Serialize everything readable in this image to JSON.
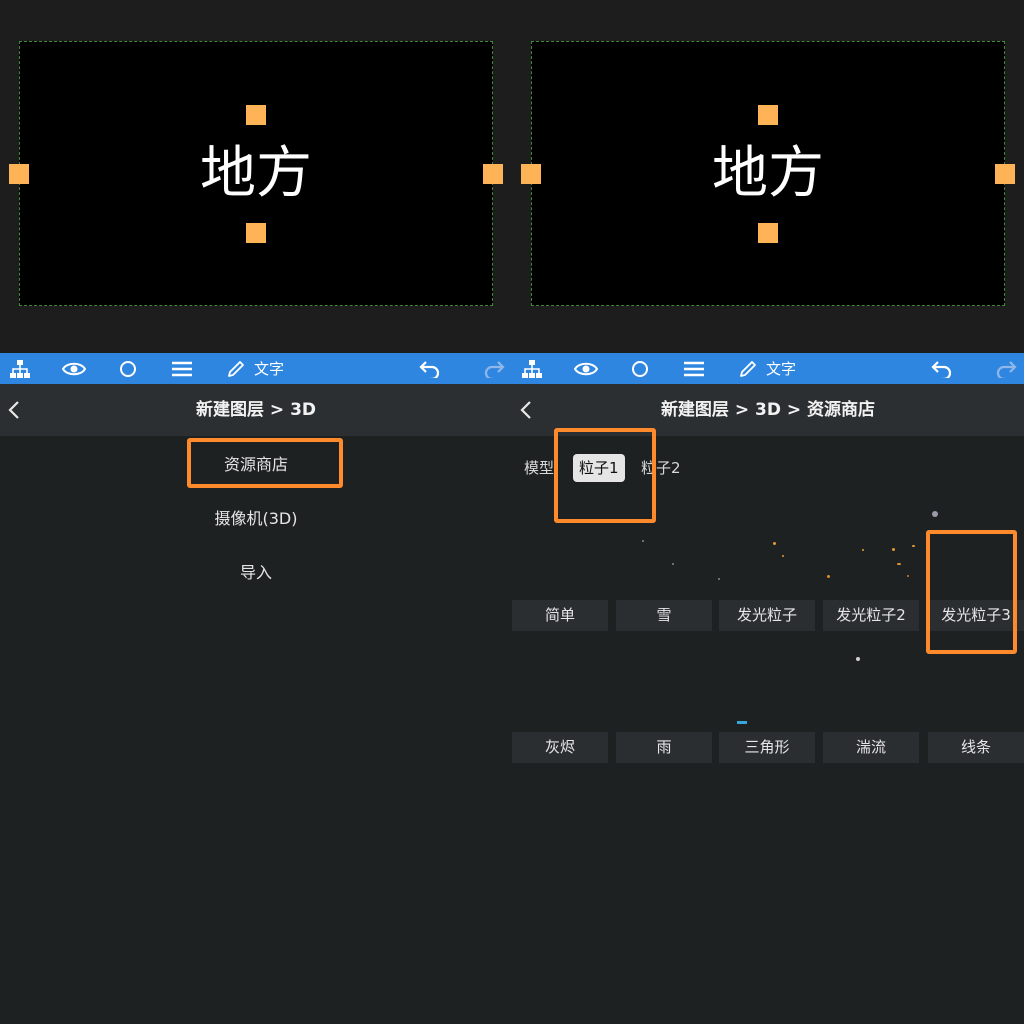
{
  "canvas": {
    "text": "地方"
  },
  "toolbar": {
    "text_label": "文字"
  },
  "left": {
    "nav_title": "新建图层 > 3D",
    "menu": [
      "资源商店",
      "摄像机(3D)",
      "导入"
    ]
  },
  "right": {
    "nav_title": "新建图层 > 3D > 资源商店",
    "tabs": [
      "模型",
      "粒子1",
      "粒子2"
    ],
    "row1": [
      "简单",
      "雪",
      "发光粒子",
      "发光粒子2",
      "发光粒子3"
    ],
    "row2": [
      "灰烬",
      "雨",
      "三角形",
      "湍流",
      "线条"
    ]
  },
  "colors": {
    "toolbar": "#2f86e0",
    "handle": "#ffb357",
    "highlight": "#ff8a2b",
    "background": "#1e2122",
    "navbar": "#2c2f31",
    "canvas": "#000000"
  },
  "icons": [
    "hierarchy-icon",
    "eye-icon",
    "circle-icon",
    "menu-icon",
    "pencil-icon",
    "undo-icon",
    "redo-icon",
    "back-chevron-icon",
    "chevron-right-icon",
    "help-icon"
  ]
}
